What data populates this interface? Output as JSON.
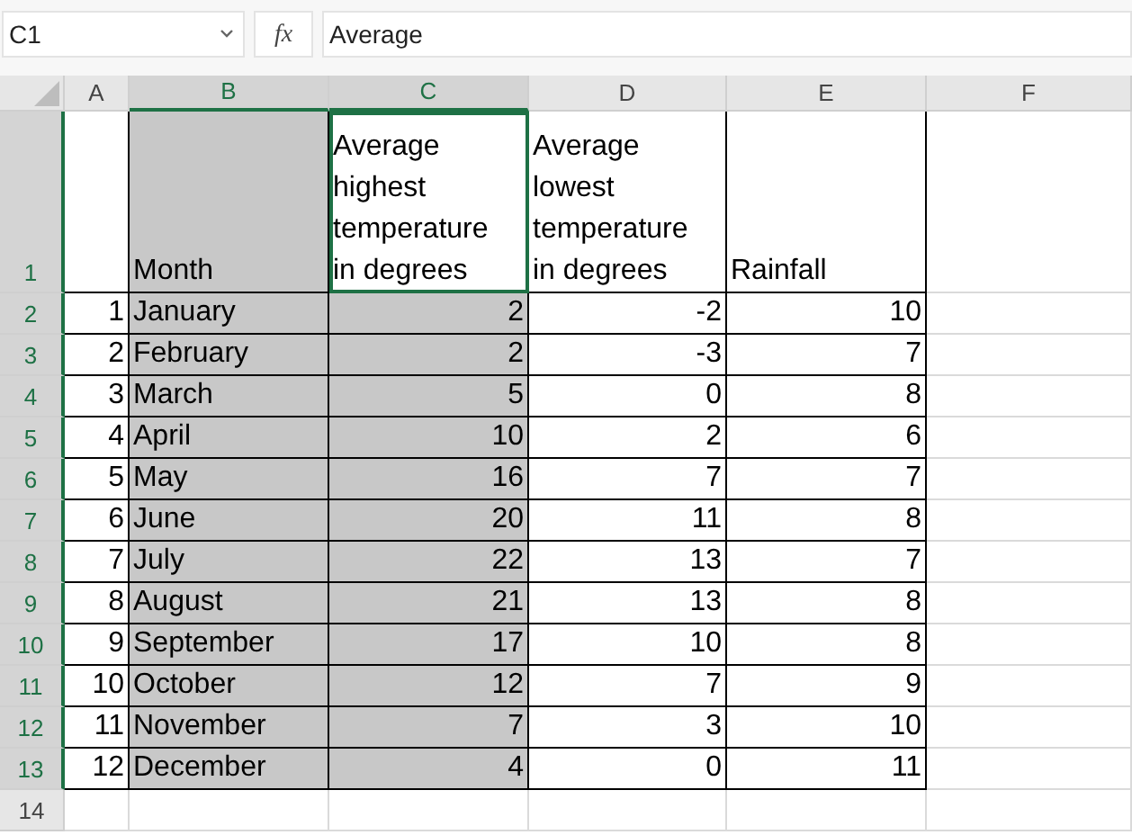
{
  "formula_bar": {
    "name_box": "C1",
    "fx": "fx",
    "formula": "Average"
  },
  "columns": [
    {
      "label": "A",
      "selected": false
    },
    {
      "label": "B",
      "selected": true
    },
    {
      "label": "C",
      "selected": true
    },
    {
      "label": "D",
      "selected": false
    },
    {
      "label": "E",
      "selected": false
    },
    {
      "label": "F",
      "selected": false
    }
  ],
  "rows": [
    {
      "label": "1",
      "selected": true,
      "bordered": true,
      "cells": [
        {
          "selected": false
        },
        {
          "text": "Month",
          "kind": "text",
          "selected": true
        },
        {
          "text": "Average highest temperature in degrees",
          "kind": "text",
          "active": true
        },
        {
          "text": "Average lowest temperature in degrees",
          "kind": "text",
          "selected": false
        },
        {
          "text": "Rainfall",
          "kind": "text",
          "selected": false
        },
        {
          "selected": false
        }
      ]
    },
    {
      "label": "2",
      "selected": true,
      "bordered": true,
      "cells": [
        {
          "text": "1",
          "kind": "number",
          "selected": false
        },
        {
          "text": "January",
          "kind": "text",
          "selected": true
        },
        {
          "text": "2",
          "kind": "number",
          "selected": true
        },
        {
          "text": "-2",
          "kind": "number",
          "selected": false
        },
        {
          "text": "10",
          "kind": "number",
          "selected": false
        },
        {
          "selected": false
        }
      ]
    },
    {
      "label": "3",
      "selected": true,
      "bordered": true,
      "cells": [
        {
          "text": "2",
          "kind": "number",
          "selected": false
        },
        {
          "text": "February",
          "kind": "text",
          "selected": true
        },
        {
          "text": "2",
          "kind": "number",
          "selected": true
        },
        {
          "text": "-3",
          "kind": "number",
          "selected": false
        },
        {
          "text": "7",
          "kind": "number",
          "selected": false
        },
        {
          "selected": false
        }
      ]
    },
    {
      "label": "4",
      "selected": true,
      "bordered": true,
      "cells": [
        {
          "text": "3",
          "kind": "number",
          "selected": false
        },
        {
          "text": "March",
          "kind": "text",
          "selected": true
        },
        {
          "text": "5",
          "kind": "number",
          "selected": true
        },
        {
          "text": "0",
          "kind": "number",
          "selected": false
        },
        {
          "text": "8",
          "kind": "number",
          "selected": false
        },
        {
          "selected": false
        }
      ]
    },
    {
      "label": "5",
      "selected": true,
      "bordered": true,
      "cells": [
        {
          "text": "4",
          "kind": "number",
          "selected": false
        },
        {
          "text": "April",
          "kind": "text",
          "selected": true
        },
        {
          "text": "10",
          "kind": "number",
          "selected": true
        },
        {
          "text": "2",
          "kind": "number",
          "selected": false
        },
        {
          "text": "6",
          "kind": "number",
          "selected": false
        },
        {
          "selected": false
        }
      ]
    },
    {
      "label": "6",
      "selected": true,
      "bordered": true,
      "cells": [
        {
          "text": "5",
          "kind": "number",
          "selected": false
        },
        {
          "text": "May",
          "kind": "text",
          "selected": true
        },
        {
          "text": "16",
          "kind": "number",
          "selected": true
        },
        {
          "text": "7",
          "kind": "number",
          "selected": false
        },
        {
          "text": "7",
          "kind": "number",
          "selected": false
        },
        {
          "selected": false
        }
      ]
    },
    {
      "label": "7",
      "selected": true,
      "bordered": true,
      "cells": [
        {
          "text": "6",
          "kind": "number",
          "selected": false
        },
        {
          "text": "June",
          "kind": "text",
          "selected": true
        },
        {
          "text": "20",
          "kind": "number",
          "selected": true
        },
        {
          "text": "11",
          "kind": "number",
          "selected": false
        },
        {
          "text": "8",
          "kind": "number",
          "selected": false
        },
        {
          "selected": false
        }
      ]
    },
    {
      "label": "8",
      "selected": true,
      "bordered": true,
      "cells": [
        {
          "text": "7",
          "kind": "number",
          "selected": false
        },
        {
          "text": "July",
          "kind": "text",
          "selected": true
        },
        {
          "text": "22",
          "kind": "number",
          "selected": true
        },
        {
          "text": "13",
          "kind": "number",
          "selected": false
        },
        {
          "text": "7",
          "kind": "number",
          "selected": false
        },
        {
          "selected": false
        }
      ]
    },
    {
      "label": "9",
      "selected": true,
      "bordered": true,
      "cells": [
        {
          "text": "8",
          "kind": "number",
          "selected": false
        },
        {
          "text": "August",
          "kind": "text",
          "selected": true
        },
        {
          "text": "21",
          "kind": "number",
          "selected": true
        },
        {
          "text": "13",
          "kind": "number",
          "selected": false
        },
        {
          "text": "8",
          "kind": "number",
          "selected": false
        },
        {
          "selected": false
        }
      ]
    },
    {
      "label": "10",
      "selected": true,
      "bordered": true,
      "cells": [
        {
          "text": "9",
          "kind": "number",
          "selected": false
        },
        {
          "text": "September",
          "kind": "text",
          "selected": true
        },
        {
          "text": "17",
          "kind": "number",
          "selected": true
        },
        {
          "text": "10",
          "kind": "number",
          "selected": false
        },
        {
          "text": "8",
          "kind": "number",
          "selected": false
        },
        {
          "selected": false
        }
      ]
    },
    {
      "label": "11",
      "selected": true,
      "bordered": true,
      "cells": [
        {
          "text": "10",
          "kind": "number",
          "selected": false
        },
        {
          "text": "October",
          "kind": "text",
          "selected": true
        },
        {
          "text": "12",
          "kind": "number",
          "selected": true
        },
        {
          "text": "7",
          "kind": "number",
          "selected": false
        },
        {
          "text": "9",
          "kind": "number",
          "selected": false
        },
        {
          "selected": false
        }
      ]
    },
    {
      "label": "12",
      "selected": true,
      "bordered": true,
      "cells": [
        {
          "text": "11",
          "kind": "number",
          "selected": false
        },
        {
          "text": "November",
          "kind": "text",
          "selected": true
        },
        {
          "text": "7",
          "kind": "number",
          "selected": true
        },
        {
          "text": "3",
          "kind": "number",
          "selected": false
        },
        {
          "text": "10",
          "kind": "number",
          "selected": false
        },
        {
          "selected": false
        }
      ]
    },
    {
      "label": "13",
      "selected": true,
      "bordered": true,
      "cells": [
        {
          "text": "12",
          "kind": "number",
          "selected": false
        },
        {
          "text": "December",
          "kind": "text",
          "selected": true
        },
        {
          "text": "4",
          "kind": "number",
          "selected": true
        },
        {
          "text": "0",
          "kind": "number",
          "selected": false
        },
        {
          "text": "11",
          "kind": "number",
          "selected": false
        },
        {
          "selected": false
        }
      ]
    },
    {
      "label": "14",
      "selected": false,
      "bordered": false,
      "cells": [
        {
          "selected": false
        },
        {
          "selected": false
        },
        {
          "selected": false
        },
        {
          "selected": false
        },
        {
          "selected": false
        },
        {
          "selected": false
        }
      ]
    }
  ]
}
